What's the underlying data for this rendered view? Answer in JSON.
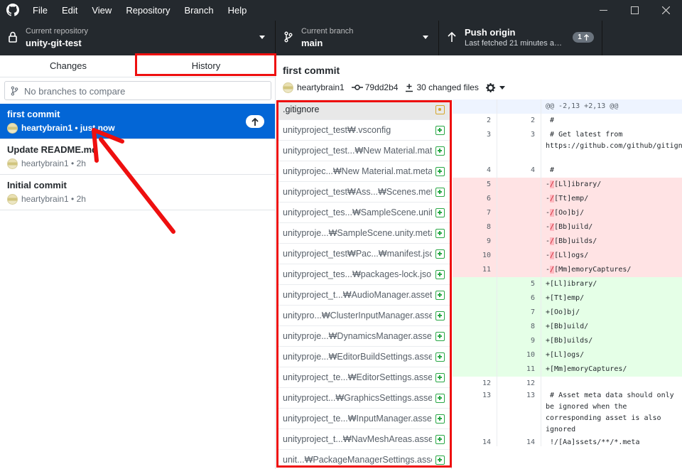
{
  "titlebar": {
    "menu": [
      "File",
      "Edit",
      "View",
      "Repository",
      "Branch",
      "Help"
    ]
  },
  "toolbar": {
    "repo_label": "Current repository",
    "repo_value": "unity-git-test",
    "branch_label": "Current branch",
    "branch_value": "main",
    "push_label": "Push origin",
    "push_sub": "Last fetched 21 minutes a…",
    "push_count": "1"
  },
  "tabs": {
    "changes": "Changes",
    "history": "History"
  },
  "branch_filter": {
    "placeholder": "No branches to compare"
  },
  "commits": [
    {
      "title": "first commit",
      "author": "heartybrain1",
      "time": "just now"
    },
    {
      "title": "Update README.md",
      "author": "heartybrain1",
      "time": "2h"
    },
    {
      "title": "Initial commit",
      "author": "heartybrain1",
      "time": "2h"
    }
  ],
  "selected_commit": {
    "title": "first commit",
    "author": "heartybrain1",
    "sha": "79dd2b4",
    "changed_files": "30 changed files"
  },
  "files": [
    {
      "name": ".gitignore",
      "status": "modified"
    },
    {
      "name": "unityproject_test₩.vsconfig",
      "status": "added"
    },
    {
      "name": "unityproject_test...₩New Material.mat",
      "status": "added"
    },
    {
      "name": "unityprojec...₩New Material.mat.meta",
      "status": "added"
    },
    {
      "name": "unityproject_test₩Ass...₩Scenes.meta",
      "status": "added"
    },
    {
      "name": "unityproject_tes...₩SampleScene.unity",
      "status": "added"
    },
    {
      "name": "unityproje...₩SampleScene.unity.meta",
      "status": "added"
    },
    {
      "name": "unityproject_test₩Pac...₩manifest.json",
      "status": "added"
    },
    {
      "name": "unityproject_tes...₩packages-lock.json",
      "status": "added"
    },
    {
      "name": "unityproject_t...₩AudioManager.asset",
      "status": "added"
    },
    {
      "name": "unitypro...₩ClusterInputManager.asset",
      "status": "added"
    },
    {
      "name": "unityproje...₩DynamicsManager.asset",
      "status": "added"
    },
    {
      "name": "unityproje...₩EditorBuildSettings.asset",
      "status": "added"
    },
    {
      "name": "unityproject_te...₩EditorSettings.asset",
      "status": "added"
    },
    {
      "name": "unityproject...₩GraphicsSettings.asset",
      "status": "added"
    },
    {
      "name": "unityproject_te...₩InputManager.asset",
      "status": "added"
    },
    {
      "name": "unityproject_t...₩NavMeshAreas.asset",
      "status": "added"
    },
    {
      "name": "unit...₩PackageManagerSettings.asset",
      "status": "added"
    }
  ],
  "diff": [
    {
      "type": "hunk",
      "old": "",
      "new": "",
      "text": "@@ -2,13 +2,13 @@"
    },
    {
      "type": "ctx",
      "old": "2",
      "new": "2",
      "text": " #"
    },
    {
      "type": "ctx",
      "old": "3",
      "new": "3",
      "text": " # Get latest from https://github.com/github/gitignore/blob/master/Unity.gitignore"
    },
    {
      "type": "ctx",
      "old": "4",
      "new": "4",
      "text": " #"
    },
    {
      "type": "del",
      "old": "5",
      "new": "",
      "text": "[Ll]ibrary/"
    },
    {
      "type": "del",
      "old": "6",
      "new": "",
      "text": "[Tt]emp/"
    },
    {
      "type": "del",
      "old": "7",
      "new": "",
      "text": "[Oo]bj/"
    },
    {
      "type": "del",
      "old": "8",
      "new": "",
      "text": "[Bb]uild/"
    },
    {
      "type": "del",
      "old": "9",
      "new": "",
      "text": "[Bb]uilds/"
    },
    {
      "type": "del",
      "old": "10",
      "new": "",
      "text": "[Ll]ogs/"
    },
    {
      "type": "del",
      "old": "11",
      "new": "",
      "text": "[Mm]emoryCaptures/"
    },
    {
      "type": "add",
      "old": "",
      "new": "5",
      "text": "+[Ll]ibrary/"
    },
    {
      "type": "add",
      "old": "",
      "new": "6",
      "text": "+[Tt]emp/"
    },
    {
      "type": "add",
      "old": "",
      "new": "7",
      "text": "+[Oo]bj/"
    },
    {
      "type": "add",
      "old": "",
      "new": "8",
      "text": "+[Bb]uild/"
    },
    {
      "type": "add",
      "old": "",
      "new": "9",
      "text": "+[Bb]uilds/"
    },
    {
      "type": "add",
      "old": "",
      "new": "10",
      "text": "+[Ll]ogs/"
    },
    {
      "type": "add",
      "old": "",
      "new": "11",
      "text": "+[Mm]emoryCaptures/"
    },
    {
      "type": "ctx",
      "old": "12",
      "new": "12",
      "text": ""
    },
    {
      "type": "ctx",
      "old": "13",
      "new": "13",
      "text": " # Asset meta data should only be ignored when the corresponding asset is also ignored"
    },
    {
      "type": "ctx",
      "old": "14",
      "new": "14",
      "text": " !/[Aa]ssets/**/*.meta"
    }
  ],
  "colors": {
    "toolbar_bg": "#24292e",
    "selection_blue": "#0366d6",
    "annotation_red": "#ee0f0f",
    "added_green": "#28a745",
    "deleted_bg": "#ffe3e4",
    "added_bg": "#e5ffe7"
  },
  "icons": [
    "github-logo-icon",
    "lock-icon",
    "branch-icon",
    "arrow-up-icon",
    "gear-icon",
    "commit-icon",
    "diff-icon",
    "minimize-icon",
    "maximize-icon",
    "close-icon"
  ]
}
